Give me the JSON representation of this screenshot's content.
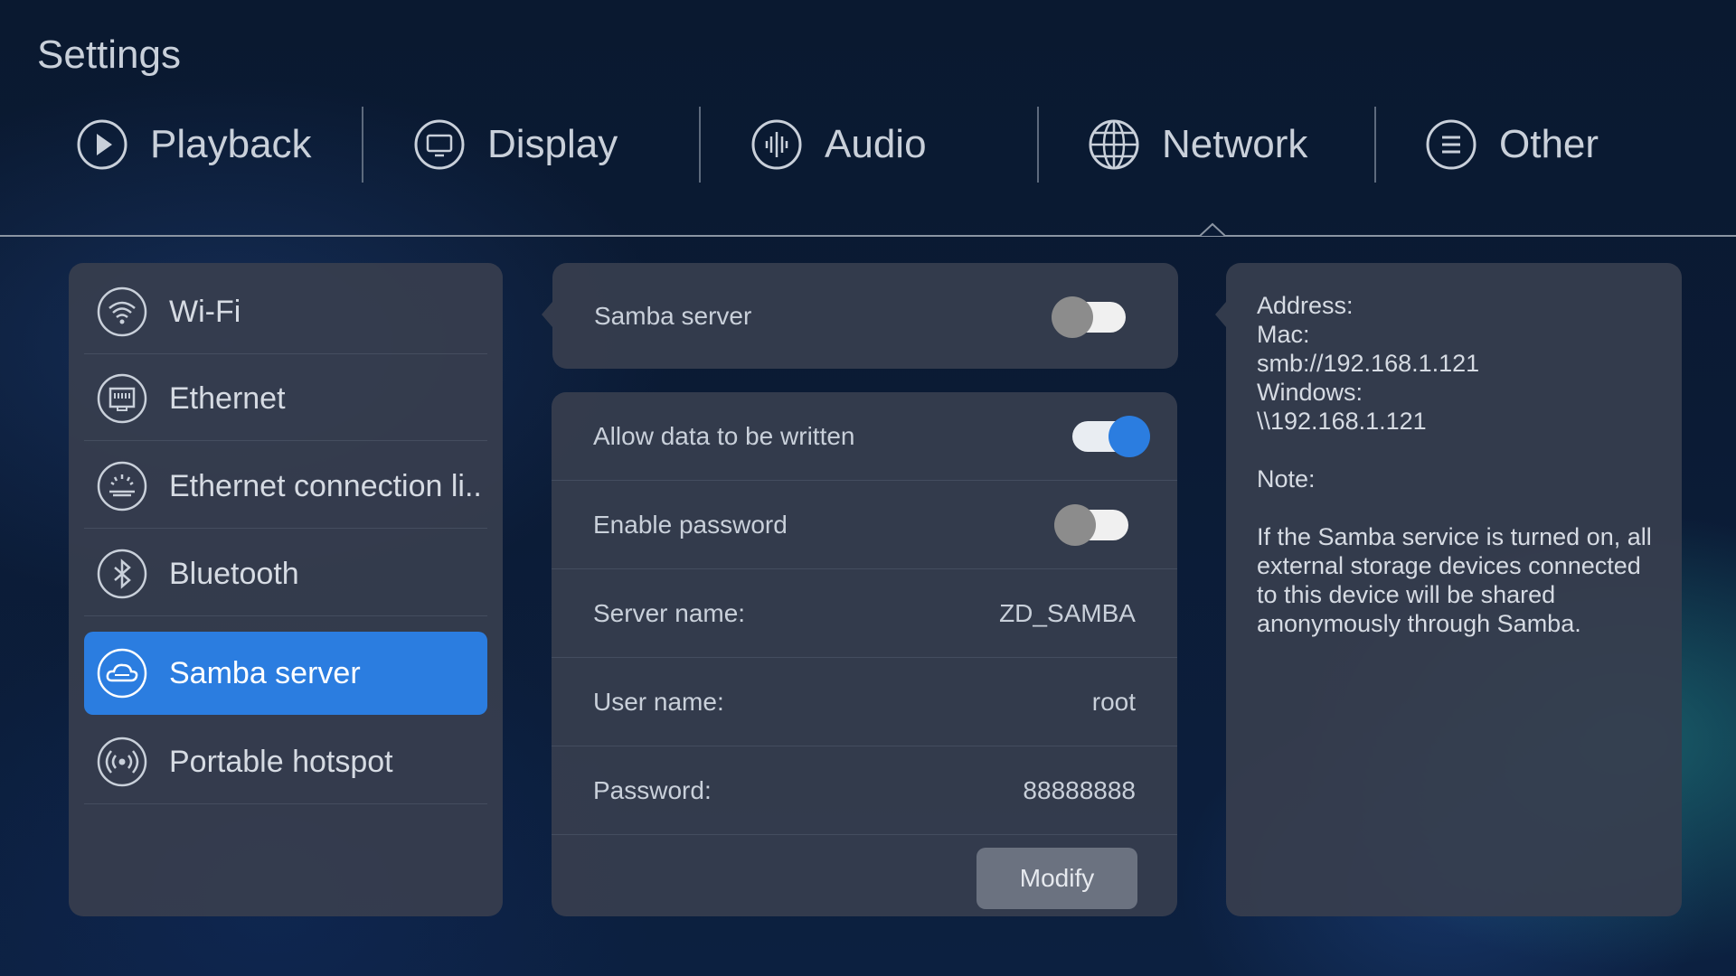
{
  "header": {
    "title": "Settings"
  },
  "tabs": [
    {
      "label": "Playback",
      "icon": "play-circle-icon"
    },
    {
      "label": "Display",
      "icon": "monitor-icon"
    },
    {
      "label": "Audio",
      "icon": "audio-wave-icon"
    },
    {
      "label": "Network",
      "icon": "globe-icon",
      "active": true
    },
    {
      "label": "Other",
      "icon": "menu-circle-icon"
    }
  ],
  "sidebar": {
    "items": [
      {
        "label": "Wi-Fi",
        "icon": "wifi-icon"
      },
      {
        "label": "Ethernet",
        "icon": "ethernet-icon"
      },
      {
        "label": "Ethernet connection li..",
        "icon": "ethernet-connection-icon"
      },
      {
        "label": "Bluetooth",
        "icon": "bluetooth-icon"
      },
      {
        "label": "Samba server",
        "icon": "samba-cloud-icon",
        "active": true
      },
      {
        "label": "Portable hotspot",
        "icon": "hotspot-icon"
      }
    ]
  },
  "samba": {
    "server_label": "Samba server",
    "server_enabled": false,
    "allow_write_label": "Allow data to be written",
    "allow_write_enabled": true,
    "enable_password_label": "Enable password",
    "enable_password_enabled": false,
    "server_name_label": "Server name:",
    "server_name_value": "ZD_SAMBA",
    "user_name_label": "User name:",
    "user_name_value": "root",
    "password_label": "Password:",
    "password_value": "88888888",
    "modify_label": "Modify"
  },
  "info": {
    "address_label": "Address:",
    "mac_label": "Mac:",
    "smb_address": "smb://192.168.1.121",
    "windows_label": "Windows:",
    "windows_address": "\\\\192.168.1.121",
    "note_label": "Note:",
    "note_text": "If the Samba service is turned on, all external storage devices connected to this device will be shared anonymously through Samba."
  },
  "colors": {
    "accent": "#2b7de0",
    "panel": "#373e4e",
    "background": "#0b1b35"
  }
}
